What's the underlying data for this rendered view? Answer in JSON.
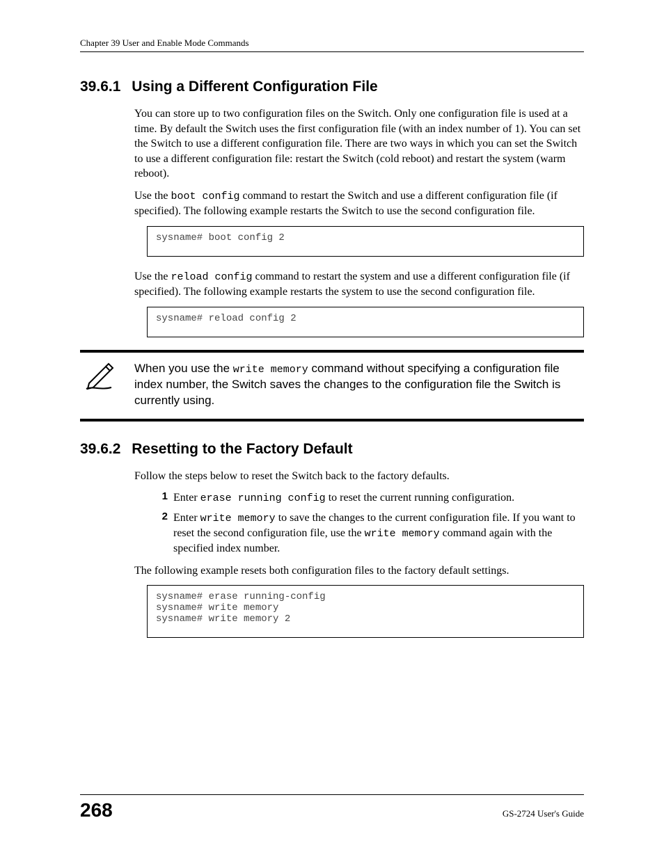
{
  "header": {
    "chapter": "Chapter 39 User and Enable Mode Commands"
  },
  "section1": {
    "number": "39.6.1",
    "title": "Using a Different Configuration File",
    "para1": "You can store up to two configuration files on the Switch. Only one configuration file is used at a time. By default the Switch uses the first configuration file (with an index number of 1). You can set the Switch to use a different configuration file. There are two ways in which you can set the Switch to use a different configuration file: restart the Switch (cold reboot) and restart the system (warm reboot).",
    "para2a": "Use the ",
    "para2_mono": "boot config",
    "para2b": " command to restart the Switch and use a different configuration file (if specified). The following example restarts the Switch to use the second configuration file.",
    "code1": "sysname# boot config 2",
    "para3a": "Use the ",
    "para3_mono": "reload config",
    "para3b": " command to restart the system and use a different configuration file (if specified). The following example restarts the system to use the second configuration file.",
    "code2": "sysname# reload config 2",
    "note_a": "When you use the ",
    "note_mono": "write memory",
    "note_b": " command without specifying a configuration file index number, the Switch saves the changes to the configuration file the Switch is currently using."
  },
  "section2": {
    "number": "39.6.2",
    "title": "Resetting to the Factory Default",
    "para1": "Follow the steps below to reset the Switch back to the factory defaults.",
    "steps": [
      {
        "num": "1",
        "pre": "Enter ",
        "mono": "erase running config",
        "post": " to reset the current running configuration."
      },
      {
        "num": "2",
        "pre": "Enter ",
        "mono": "write memory",
        "post": " to save the changes to the current configuration file. If you want to reset the second configuration file, use the ",
        "mono2": "write memory",
        "post2": " command again with the specified index number."
      }
    ],
    "para2": "The following example resets both configuration files to the factory default settings.",
    "code": "sysname# erase running-config\nsysname# write memory\nsysname# write memory 2"
  },
  "footer": {
    "page": "268",
    "guide": "GS-2724 User's Guide"
  }
}
